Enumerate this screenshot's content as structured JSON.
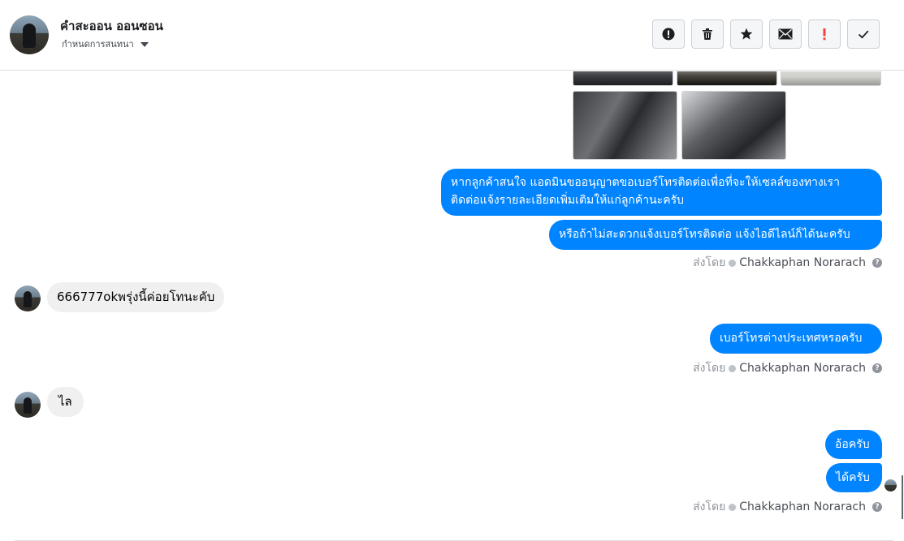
{
  "header": {
    "contact_name": "คำสะออน ออนซอน",
    "contact_subtitle": "กำหนดการสนทนา",
    "actions": [
      {
        "name": "report-button",
        "icon": "alert-circle-icon"
      },
      {
        "name": "delete-button",
        "icon": "trash-icon"
      },
      {
        "name": "star-button",
        "icon": "star-icon"
      },
      {
        "name": "mark-unread-button",
        "icon": "envelope-icon"
      },
      {
        "name": "important-button",
        "icon": "exclamation-icon"
      },
      {
        "name": "done-button",
        "icon": "checkmark-icon"
      }
    ]
  },
  "messages": {
    "out_1_line1": "หากลูกค้าสนใจ แอดมินขออนุญาตขอเบอร์โทรติดต่อเพื่อที่จะให้เซลล์ของทางเรา",
    "out_1_line2": "ติดต่อแจ้งรายละเอียดเพิ่มเติมให้แก่ลูกค้านะครับ",
    "out_2": "หรือถ้าไม่สะดวกแจ้งเบอร์โทรติดต่อ แจ้งไอดีไลน์ก็ได้นะครับ",
    "in_1": "666777okพรุ่งนี้ค่อยโทนะคับ",
    "out_3": "เบอร์โทรต่างประเทศหรอครับ",
    "in_2": "ไล",
    "out_4": "อ้อครับ",
    "out_5": "ได้ครับ"
  },
  "sent_by": {
    "prefix": "ส่งโดย",
    "sender": "Chakkaphan Norarach",
    "help": "?"
  },
  "colors": {
    "outgoing_bubble": "#0084ff",
    "incoming_bubble": "#f1f0f0",
    "important_icon": "#fa3e3e"
  }
}
